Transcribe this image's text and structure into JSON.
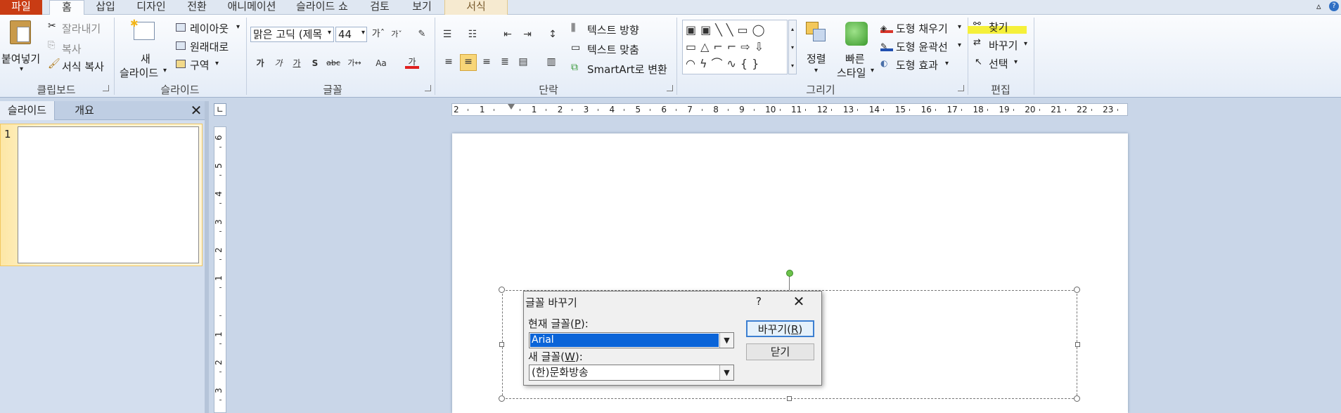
{
  "tabs": {
    "file": "파일",
    "home": "홈",
    "insert": "삽입",
    "design": "디자인",
    "transitions": "전환",
    "animations": "애니메이션",
    "slideshow": "슬라이드 쇼",
    "review": "검토",
    "view": "보기",
    "format": "서식"
  },
  "clipboard": {
    "paste": "붙여넣기",
    "cut": "잘라내기",
    "copy": "복사",
    "format_painter": "서식 복사",
    "label": "클립보드"
  },
  "slides_group": {
    "new_slide_line1": "새",
    "new_slide_line2": "슬라이드",
    "layout": "레이아웃",
    "reset": "원래대로",
    "section": "구역",
    "label": "슬라이드"
  },
  "font_group": {
    "font_name": "맑은 고딕 (제목",
    "font_size": "44",
    "label": "글꼴"
  },
  "paragraph_group": {
    "text_direction": "텍스트 방향",
    "align_text": "텍스트 맞춤",
    "smartart": "SmartArt로 변환",
    "label": "단락"
  },
  "drawing_group": {
    "arrange": "정렬",
    "quick_styles_line1": "빠른",
    "quick_styles_line2": "스타일",
    "shape_fill": "도형 채우기",
    "shape_outline": "도형 윤곽선",
    "shape_effects": "도형 효과",
    "label": "그리기"
  },
  "editing_group": {
    "find": "찾기",
    "replace": "바꾸기",
    "select": "선택",
    "label": "편집"
  },
  "left_pane": {
    "tab_slides": "슬라이드",
    "tab_outline": "개요",
    "slide_number": "1"
  },
  "ruler": {
    "h_ticks": [
      "2",
      "1",
      "",
      "1",
      "2",
      "3",
      "4",
      "5",
      "6",
      "7",
      "8",
      "9",
      "10",
      "11",
      "12",
      "13",
      "14",
      "15",
      "16",
      "17",
      "18",
      "19",
      "20",
      "21",
      "22",
      "23"
    ],
    "v_ticks": [
      "6",
      "5",
      "4",
      "3",
      "2",
      "1",
      "",
      "1",
      "2",
      "3"
    ]
  },
  "dialog": {
    "title": "글꼴 바꾸기",
    "help": "?",
    "current_font_label": "현재 글꼴(",
    "current_font_key": "P",
    "new_font_label": "새 글꼴(",
    "new_font_key": "W",
    "current_font_value": "Arial",
    "new_font_value": "(한)문화방송",
    "replace_button": "바꾸기(",
    "replace_key": "R",
    "close_button": "닫기"
  },
  "colors": {
    "file_tab": "#c93c14",
    "highlight": "#f5f03a",
    "selection": "#0a64d8",
    "rotate_handle": "#6cc24a"
  }
}
